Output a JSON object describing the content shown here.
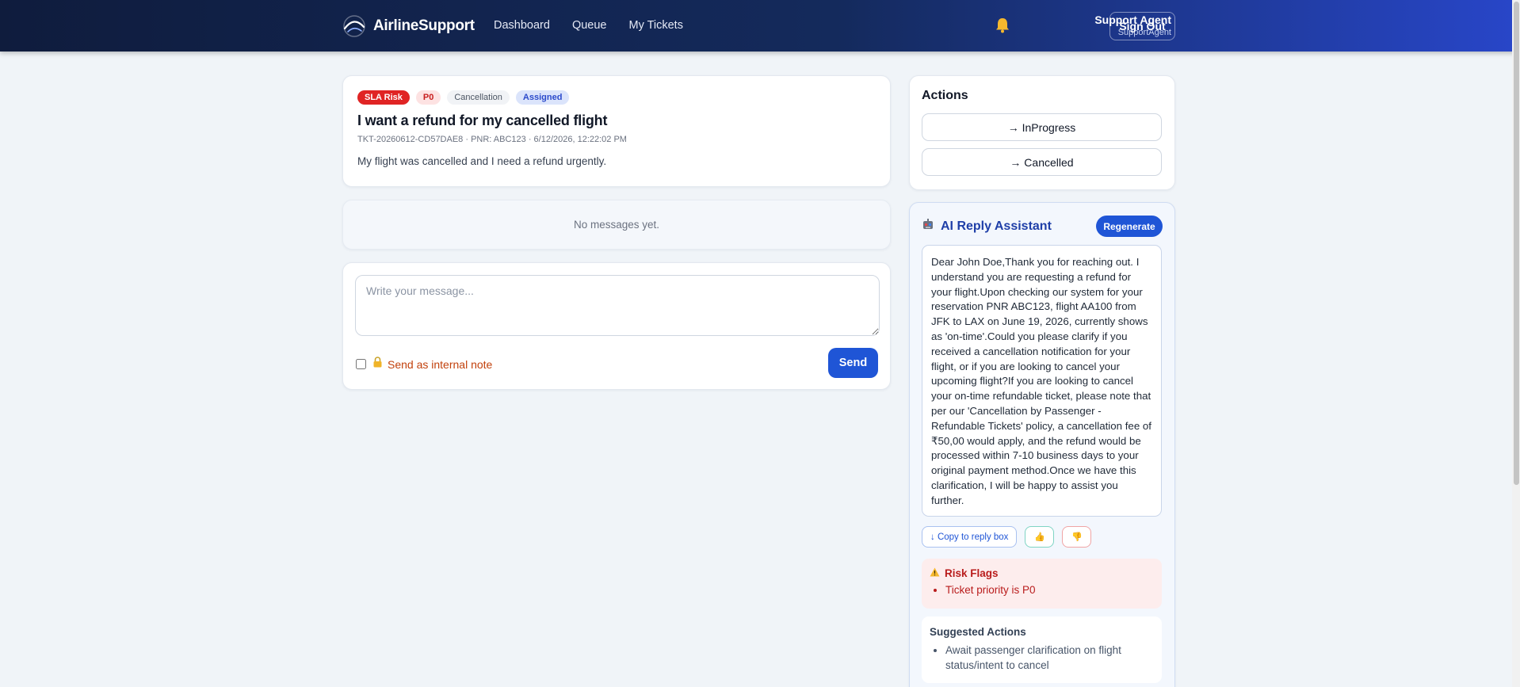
{
  "header": {
    "brand": "AirlineSupport",
    "nav": [
      "Dashboard",
      "Queue",
      "My Tickets"
    ],
    "user_name": "Support Agent",
    "user_role": "SupportAgent",
    "signout": "Sign Out"
  },
  "ticket": {
    "badges": {
      "sla": "SLA Risk",
      "priority": "P0",
      "category": "Cancellation",
      "status": "Assigned"
    },
    "title": "I want a refund for my cancelled flight",
    "meta": "TKT-20260612-CD57DAE8 · PNR: ABC123 · 6/12/2026, 12:22:02 PM",
    "description": "My flight was cancelled and I need a refund urgently."
  },
  "messages": {
    "empty": "No messages yet."
  },
  "composer": {
    "placeholder": "Write your message...",
    "internal_label": "Send as internal note",
    "send": "Send"
  },
  "actions": {
    "title": "Actions",
    "buttons": [
      "→ InProgress",
      "→ Cancelled"
    ]
  },
  "ai": {
    "title": "AI Reply Assistant",
    "regenerate": "Regenerate",
    "reply": "Dear John Doe,Thank you for reaching out. I understand you are requesting a refund for your flight.Upon checking our system for your reservation PNR ABC123, flight AA100 from JFK to LAX on June 19, 2026, currently shows as 'on-time'.Could you please clarify if you received a cancellation notification for your flight, or if you are looking to cancel your upcoming flight?If you are looking to cancel your on-time refundable ticket, please note that per our 'Cancellation by Passenger - Refundable Tickets' policy, a cancellation fee of ₹50,00 would apply, and the refund would be processed within 7-10 business days to your original payment method.Once we have this clarification, I will be happy to assist you further.",
    "copy": "↓ Copy to reply box",
    "thumb_up": "👍",
    "thumb_down": "👎",
    "risk_title": "Risk Flags",
    "risk_items": [
      "Ticket priority is P0"
    ],
    "suggest_title": "Suggested Actions",
    "suggest_items": [
      "Await passenger clarification on flight status/intent to cancel"
    ]
  },
  "colors": {
    "accent": "#1f55d6",
    "header_start": "#0f1c3d",
    "header_end": "#2846c9",
    "danger": "#e02424"
  }
}
